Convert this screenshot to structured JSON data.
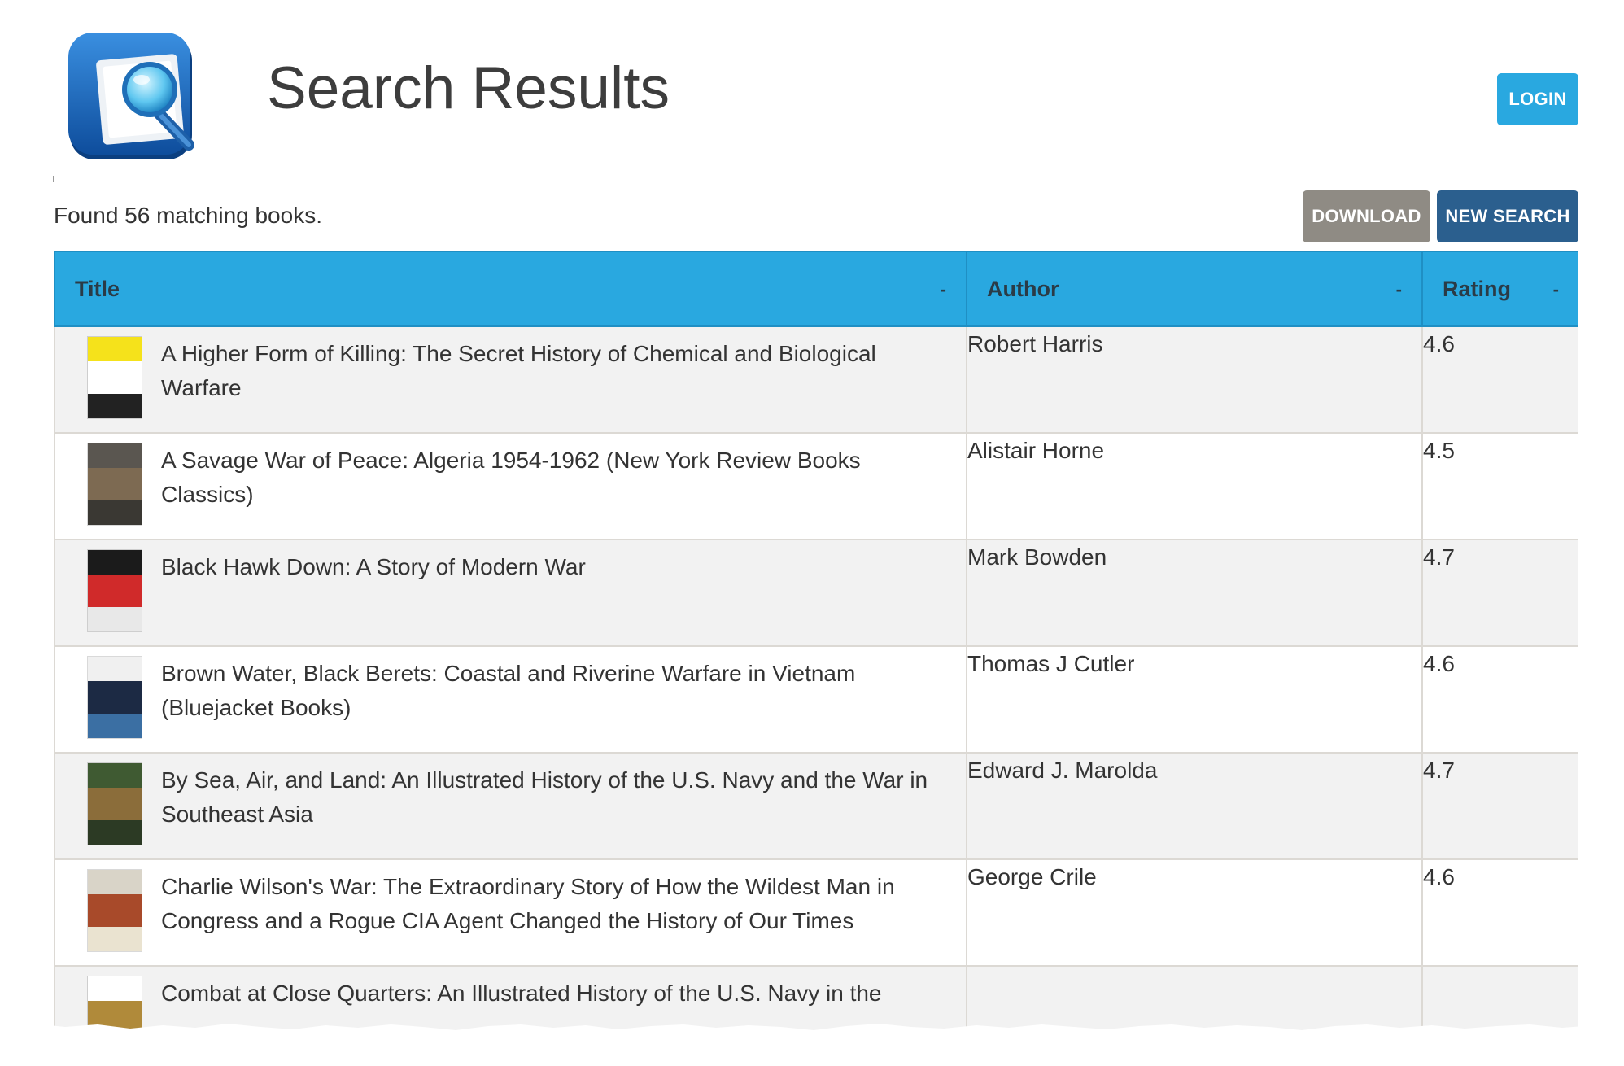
{
  "header": {
    "title": "Search Results",
    "logo_icon": "search-document-icon",
    "login_label": "LOGIN"
  },
  "toolbar": {
    "result_count": "Found 56 matching books.",
    "download_label": "DOWNLOAD",
    "new_search_label": "NEW SEARCH"
  },
  "colors": {
    "accent": "#29a8e0",
    "download": "#8f8b84",
    "new_search": "#2b5f8e"
  },
  "table": {
    "columns": [
      {
        "label": "Title",
        "sort_icon": "-"
      },
      {
        "label": "Author",
        "sort_icon": "-"
      },
      {
        "label": "Rating",
        "sort_icon": "-"
      }
    ],
    "rows": [
      {
        "title": "A Higher Form of Killing: The Secret History of Chemical and Biological Warfare",
        "author": "Robert Harris",
        "rating": "4.6",
        "cover_colors": [
          "#f5e21b",
          "#ffffff",
          "#222222"
        ]
      },
      {
        "title": "A Savage War of Peace: Algeria 1954-1962 (New York Review Books Classics)",
        "author": "Alistair Horne",
        "rating": "4.5",
        "cover_colors": [
          "#5a5650",
          "#7d6a52",
          "#3a3833"
        ]
      },
      {
        "title": "Black Hawk Down: A Story of Modern War",
        "author": "Mark Bowden",
        "rating": "4.7",
        "cover_colors": [
          "#1b1b1b",
          "#d02a2a",
          "#e8e8e8"
        ]
      },
      {
        "title": "Brown Water, Black Berets: Coastal and Riverine Warfare in Vietnam (Bluejacket Books)",
        "author": "Thomas J Cutler",
        "rating": "4.6",
        "cover_colors": [
          "#f0f0f0",
          "#1c2a44",
          "#3b6fa3"
        ]
      },
      {
        "title": "By Sea, Air, and Land: An Illustrated History of the U.S. Navy and the War in Southeast Asia",
        "author": "Edward J. Marolda",
        "rating": "4.7",
        "cover_colors": [
          "#3f5a32",
          "#8b6d3a",
          "#2c3a24"
        ]
      },
      {
        "title": "Charlie Wilson's War: The Extraordinary Story of How the Wildest Man in Congress and a Rogue CIA Agent Changed the History of Our Times",
        "author": "George Crile",
        "rating": "4.6",
        "cover_colors": [
          "#d9d4c8",
          "#a84a2a",
          "#eae3d0"
        ]
      },
      {
        "title": "Combat at Close Quarters: An Illustrated History of the U.S. Navy in the",
        "author": "",
        "rating": "",
        "cover_colors": [
          "#ffffff",
          "#b08a3a",
          "#7a6a3a"
        ]
      }
    ]
  }
}
